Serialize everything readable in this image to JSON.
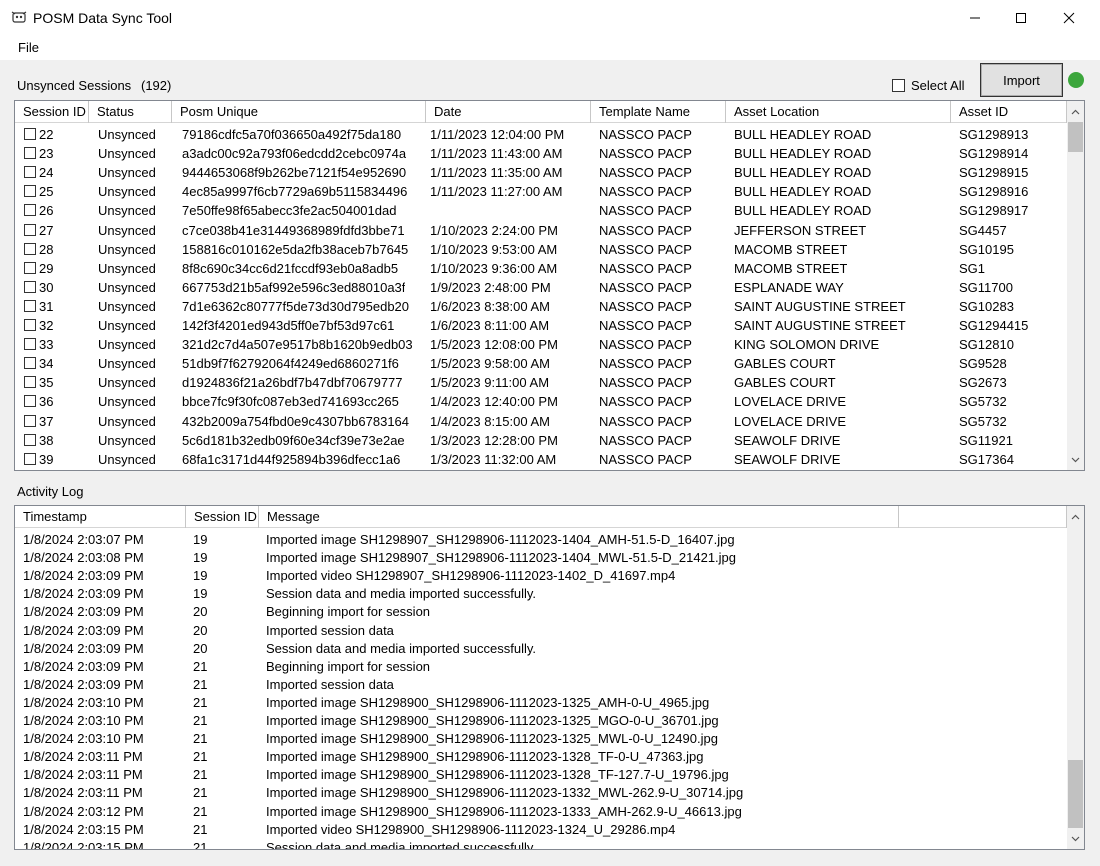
{
  "window": {
    "title": "POSM Data Sync Tool"
  },
  "menu": {
    "file": "File"
  },
  "sessions": {
    "label": "Unsynced Sessions",
    "count": "(192)",
    "select_all": "Select All",
    "import_label": "Import",
    "status_color": "#3ca63c",
    "columns": [
      "Session ID",
      "Status",
      "Posm Unique",
      "Date",
      "Template Name",
      "Asset Location",
      "Asset ID"
    ],
    "rows": [
      [
        "22",
        "Unsynced",
        "79186cdfc5a70f036650a492f75da180",
        "1/11/2023 12:04:00 PM",
        "NASSCO PACP",
        "BULL HEADLEY ROAD",
        "SG1298913"
      ],
      [
        "23",
        "Unsynced",
        "a3adc00c92a793f06edcdd2cebc0974a",
        "1/11/2023 11:43:00 AM",
        "NASSCO PACP",
        "BULL HEADLEY ROAD",
        "SG1298914"
      ],
      [
        "24",
        "Unsynced",
        "9444653068f9b262be7121f54e952690",
        "1/11/2023 11:35:00 AM",
        "NASSCO PACP",
        "BULL HEADLEY ROAD",
        "SG1298915"
      ],
      [
        "25",
        "Unsynced",
        "4ec85a9997f6cb7729a69b5115834496",
        "1/11/2023 11:27:00 AM",
        "NASSCO PACP",
        "BULL HEADLEY ROAD",
        "SG1298916"
      ],
      [
        "26",
        "Unsynced",
        "7e50ffe98f65abecc3fe2ac504001dad",
        "",
        "NASSCO PACP",
        "BULL HEADLEY ROAD",
        "SG1298917"
      ],
      [
        "27",
        "Unsynced",
        "c7ce038b41e31449368989fdfd3bbe71",
        "1/10/2023 2:24:00 PM",
        "NASSCO PACP",
        "JEFFERSON STREET",
        "SG4457"
      ],
      [
        "28",
        "Unsynced",
        "158816c010162e5da2fb38aceb7b7645",
        "1/10/2023 9:53:00 AM",
        "NASSCO PACP",
        "MACOMB STREET",
        "SG10195"
      ],
      [
        "29",
        "Unsynced",
        "8f8c690c34cc6d21fccdf93eb0a8adb5",
        "1/10/2023 9:36:00 AM",
        "NASSCO PACP",
        "MACOMB STREET",
        "SG1"
      ],
      [
        "30",
        "Unsynced",
        "667753d21b5af992e596c3ed88010a3f",
        "1/9/2023 2:48:00 PM",
        "NASSCO PACP",
        "ESPLANADE WAY",
        "SG11700"
      ],
      [
        "31",
        "Unsynced",
        "7d1e6362c80777f5de73d30d795edb20",
        "1/6/2023 8:38:00 AM",
        "NASSCO PACP",
        "SAINT AUGUSTINE STREET",
        "SG10283"
      ],
      [
        "32",
        "Unsynced",
        "142f3f4201ed943d5ff0e7bf53d97c61",
        "1/6/2023 8:11:00 AM",
        "NASSCO PACP",
        "SAINT AUGUSTINE STREET",
        "SG1294415"
      ],
      [
        "33",
        "Unsynced",
        "321d2c7d4a507e9517b8b1620b9edb03",
        "1/5/2023 12:08:00 PM",
        "NASSCO PACP",
        "KING SOLOMON DRIVE",
        "SG12810"
      ],
      [
        "34",
        "Unsynced",
        "51db9f7f62792064f4249ed6860271f6",
        "1/5/2023 9:58:00 AM",
        "NASSCO PACP",
        "GABLES COURT",
        "SG9528"
      ],
      [
        "35",
        "Unsynced",
        "d1924836f21a26bdf7b47dbf70679777",
        "1/5/2023 9:11:00 AM",
        "NASSCO PACP",
        "GABLES COURT",
        "SG2673"
      ],
      [
        "36",
        "Unsynced",
        "bbce7fc9f30fc087eb3ed741693cc265",
        "1/4/2023 12:40:00 PM",
        "NASSCO PACP",
        "LOVELACE DRIVE",
        "SG5732"
      ],
      [
        "37",
        "Unsynced",
        "432b2009a754fbd0e9c4307bb6783164",
        "1/4/2023 8:15:00 AM",
        "NASSCO PACP",
        "LOVELACE DRIVE",
        "SG5732"
      ],
      [
        "38",
        "Unsynced",
        "5c6d181b32edb09f60e34cf39e73e2ae",
        "1/3/2023 12:28:00 PM",
        "NASSCO PACP",
        "SEAWOLF DRIVE",
        "SG11921"
      ],
      [
        "39",
        "Unsynced",
        "68fa1c3171d44f925894b396dfecc1a6",
        "1/3/2023 11:32:00 AM",
        "NASSCO PACP",
        "SEAWOLF DRIVE",
        "SG17364"
      ]
    ]
  },
  "log": {
    "label": "Activity Log",
    "columns": [
      "Timestamp",
      "Session ID",
      "Message"
    ],
    "rows": [
      [
        "1/8/2024 2:03:07 PM",
        "19",
        "Imported image SH1298907_SH1298906-1112023-1404_AMH-51.5-D_16407.jpg"
      ],
      [
        "1/8/2024 2:03:08 PM",
        "19",
        "Imported image SH1298907_SH1298906-1112023-1404_MWL-51.5-D_21421.jpg"
      ],
      [
        "1/8/2024 2:03:09 PM",
        "19",
        "Imported video SH1298907_SH1298906-1112023-1402_D_41697.mp4"
      ],
      [
        "1/8/2024 2:03:09 PM",
        "19",
        "Session data and media imported successfully."
      ],
      [
        "1/8/2024 2:03:09 PM",
        "20",
        "Beginning import for session"
      ],
      [
        "1/8/2024 2:03:09 PM",
        "20",
        "Imported session data"
      ],
      [
        "1/8/2024 2:03:09 PM",
        "20",
        "Session data and media imported successfully."
      ],
      [
        "1/8/2024 2:03:09 PM",
        "21",
        "Beginning import for session"
      ],
      [
        "1/8/2024 2:03:09 PM",
        "21",
        "Imported session data"
      ],
      [
        "1/8/2024 2:03:10 PM",
        "21",
        "Imported image SH1298900_SH1298906-1112023-1325_AMH-0-U_4965.jpg"
      ],
      [
        "1/8/2024 2:03:10 PM",
        "21",
        "Imported image SH1298900_SH1298906-1112023-1325_MGO-0-U_36701.jpg"
      ],
      [
        "1/8/2024 2:03:10 PM",
        "21",
        "Imported image SH1298900_SH1298906-1112023-1325_MWL-0-U_12490.jpg"
      ],
      [
        "1/8/2024 2:03:11 PM",
        "21",
        "Imported image SH1298900_SH1298906-1112023-1328_TF-0-U_47363.jpg"
      ],
      [
        "1/8/2024 2:03:11 PM",
        "21",
        "Imported image SH1298900_SH1298906-1112023-1328_TF-127.7-U_19796.jpg"
      ],
      [
        "1/8/2024 2:03:11 PM",
        "21",
        "Imported image SH1298900_SH1298906-1112023-1332_MWL-262.9-U_30714.jpg"
      ],
      [
        "1/8/2024 2:03:12 PM",
        "21",
        "Imported image SH1298900_SH1298906-1112023-1333_AMH-262.9-U_46613.jpg"
      ],
      [
        "1/8/2024 2:03:15 PM",
        "21",
        "Imported video SH1298900_SH1298906-1112023-1324_U_29286.mp4"
      ],
      [
        "1/8/2024 2:03:15 PM",
        "21",
        "Session data and media imported successfully."
      ]
    ]
  }
}
